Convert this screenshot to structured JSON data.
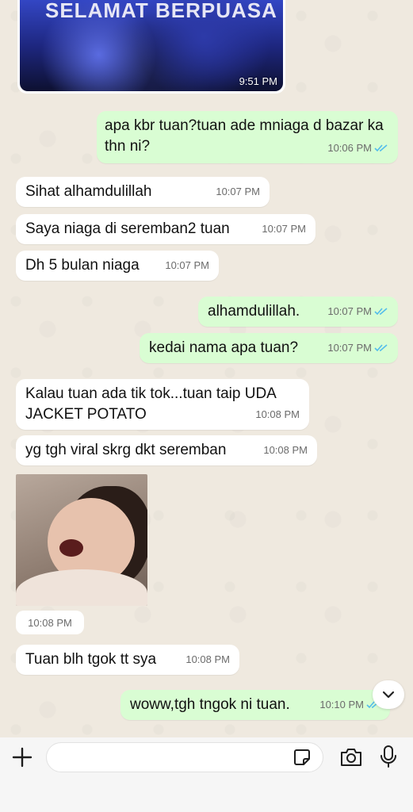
{
  "top_image": {
    "caption": "SELAMAT BERPUASA",
    "time": "9:51 PM"
  },
  "messages": [
    {
      "dir": "out",
      "text": "apa kbr tuan?tuan ade mniaga d bazar ka thn ni?",
      "time": "10:06 PM"
    },
    {
      "dir": "in",
      "text": "Sihat alhamdulillah",
      "time": "10:07 PM"
    },
    {
      "dir": "in",
      "text": "Saya niaga di seremban2 tuan",
      "time": "10:07 PM"
    },
    {
      "dir": "in",
      "text": "Dh 5 bulan niaga",
      "time": "10:07 PM"
    },
    {
      "dir": "out",
      "text": "alhamdulillah.",
      "time": "10:07 PM"
    },
    {
      "dir": "out",
      "text": "kedai nama apa tuan?",
      "time": "10:07 PM"
    },
    {
      "dir": "in",
      "text": "Kalau tuan ada tik tok...tuan taip UDA JACKET POTATO",
      "time": "10:08 PM"
    },
    {
      "dir": "in",
      "text": "yg tgh viral skrg dkt seremban",
      "time": "10:08 PM"
    },
    {
      "dir": "in",
      "text": "Tuan blh tgok tt sya",
      "time": "10:08 PM"
    },
    {
      "dir": "out",
      "text": "woww,tgh tngok ni tuan.",
      "time": "10:10 PM"
    }
  ],
  "sticker": {
    "time": "10:08 PM"
  },
  "input": {
    "placeholder": "",
    "value": ""
  },
  "icons": {
    "plus": "plus-icon",
    "sticker": "sticker-icon",
    "camera": "camera-icon",
    "mic": "microphone-icon",
    "read_receipt": "double-check-icon",
    "scroll": "chevron-down-icon"
  },
  "colors": {
    "outgoing_bubble": "#d9fdd3",
    "incoming_bubble": "#ffffff",
    "read_tick": "#53bdeb",
    "chat_background": "#efe9df"
  }
}
